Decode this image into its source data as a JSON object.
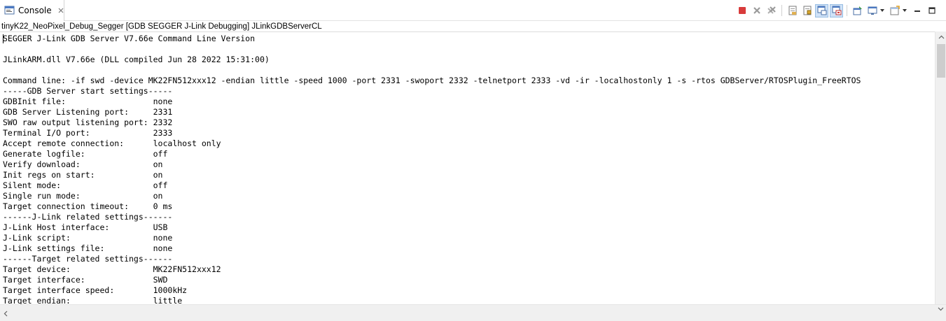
{
  "tab": {
    "label": "Console",
    "icon": "console-icon",
    "close_icon": "close-icon"
  },
  "toolbar": {
    "icons": [
      "terminate-icon",
      "remove-launch-icon",
      "remove-all-terminated-icon",
      "clear-console-icon",
      "scroll-lock-icon",
      "show-console-on-stdout-icon",
      "show-console-on-stderr-icon",
      "pin-console-icon",
      "display-selected-console-icon",
      "open-console-icon",
      "minimize-icon",
      "maximize-icon"
    ],
    "colors": {
      "terminate": "#d83b3b",
      "pressed_bg": "#cfe2f7"
    }
  },
  "process_label": "tinyK22_NeoPixel_Debug_Segger [GDB SEGGER J-Link Debugging] JLinkGDBServerCL",
  "console": {
    "lines": [
      "SEGGER J-Link GDB Server V7.66e Command Line Version",
      "",
      "JLinkARM.dll V7.66e (DLL compiled Jun 28 2022 15:31:00)",
      "",
      "Command line: -if swd -device MK22FN512xxx12 -endian little -speed 1000 -port 2331 -swoport 2332 -telnetport 2333 -vd -ir -localhostonly 1 -s -rtos GDBServer/RTOSPlugin_FreeRTOS",
      "-----GDB Server start settings-----",
      "GDBInit file:                  none",
      "GDB Server Listening port:     2331",
      "SWO raw output listening port: 2332",
      "Terminal I/O port:             2333",
      "Accept remote connection:      localhost only",
      "Generate logfile:              off",
      "Verify download:               on",
      "Init regs on start:            on",
      "Silent mode:                   off",
      "Single run mode:               on",
      "Target connection timeout:     0 ms",
      "------J-Link related settings------",
      "J-Link Host interface:         USB",
      "J-Link script:                 none",
      "J-Link settings file:          none",
      "------Target related settings------",
      "Target device:                 MK22FN512xxx12",
      "Target interface:              SWD",
      "Target interface speed:        1000kHz",
      "Target endian:                 little"
    ]
  }
}
